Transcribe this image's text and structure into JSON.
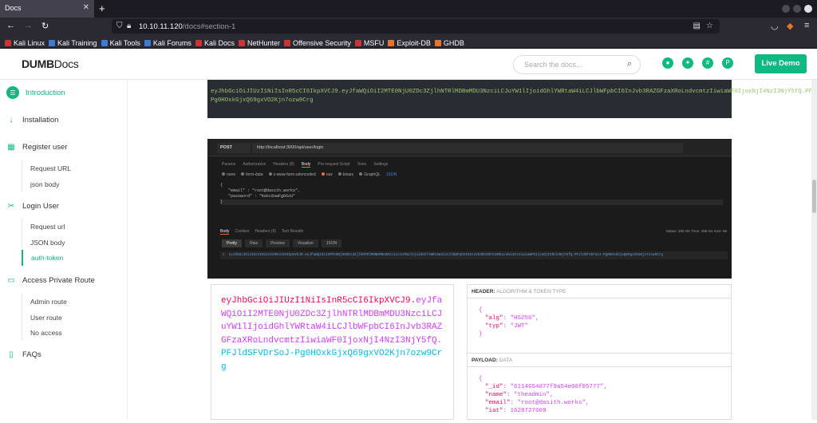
{
  "browser": {
    "tab_title": "Docs",
    "url_host": "10.10.11.120",
    "url_path": "/docs#section-1"
  },
  "bookmarks": [
    "Kali Linux",
    "Kali Training",
    "Kali Tools",
    "Kali Forums",
    "Kali Docs",
    "NetHunter",
    "Offensive Security",
    "MSFU",
    "Exploit-DB",
    "GHDB"
  ],
  "header": {
    "logo_bold": "DUMB",
    "logo_rest": "Docs",
    "search_placeholder": "Search the docs...",
    "live_demo": "Live Demo"
  },
  "sidebar": {
    "sections": [
      {
        "label": "Introduction",
        "icon": "map-signs-icon"
      },
      {
        "label": "Installation",
        "icon": "arrow-down-icon"
      },
      {
        "label": "Register user",
        "icon": "box-icon"
      },
      {
        "label": "Login User",
        "icon": "tools-icon"
      },
      {
        "label": "Access Private Route",
        "icon": "laptop-icon"
      },
      {
        "label": "FAQs",
        "icon": "tablet-icon"
      }
    ],
    "register_sub": [
      "Request URL",
      "json body"
    ],
    "login_sub": [
      "Request url",
      "JSON body",
      "auth-token"
    ],
    "private_sub": [
      "Admin route",
      "User route",
      "No access"
    ]
  },
  "token_code": "eyJhbGciOiJIUzI1NiIsInR5cCI6IkpXVCJ9.eyJfaWQiOiI2MTE0NjU0ZDc3ZjlhNTRlMDBmMDU3NzciLCJuYW1lIjoidGhlYWRtaW4iLCJlbWFpbCI6InJvb3RAZGFzaXRoLndvcmtzIiwiaWF0IjoxNjI4NzI3NjY5fQ.PFJldSFVDrSoJ-Pg0HOxkGjxQ69gxVO2Kjn7ozw9Crg",
  "postman": {
    "method": "POST",
    "url": "http://localhost:3000/api/user/login",
    "tabs": [
      "Params",
      "Authorization",
      "Headers (8)",
      "Body",
      "Pre-request Script",
      "Tests",
      "Settings"
    ],
    "body_types": [
      "none",
      "form-data",
      "x-www-form-urlencoded",
      "raw",
      "binary",
      "GraphQL",
      "JSON"
    ],
    "code_lines": [
      "{",
      "\"email\" : \"root@dasith.works\",",
      "\"password\" : \"Kekc8swFgD6zU\"",
      "}"
    ],
    "response_tabs": [
      "Body",
      "Cookies",
      "Headers (9)",
      "Test Results"
    ],
    "status": "Status: 200 OK   Time: 458 ms   Size: 66",
    "format_tabs": [
      "Pretty",
      "Raw",
      "Preview",
      "Visualize",
      "JSON"
    ],
    "response": "eyJhbGciOiJIUzI1NiIsInR5cCI6IkpXVCJ9.eyJfaWQiOiI2MTE0NjU0ZDc3ZjlhNTRlMDBmMDU3NzciLCJuYW1lIjoidGhlYWRtaW4iLCJlbWFpbCI6InJvb3RAZGFzaXRoLndvcmtzIiwiaWF0IjoxNjI4NzI3NjY5fQ.PFJldSFVDrSoJ-Pg0HOxkGjxQ69gxVO2Kjn7ozw9Crg"
  },
  "jwt": {
    "header_part": "eyJhbGciOiJIUzI1NiIsInR5cCI6IkpXVCJ9.",
    "payload_part": "eyJfaWQiOiI2MTE0NjU0ZDc3ZjlhNTRlMDBmMDU3NzciLCJuYW1lIjoidGhlYWRtaW4iLCJlbWFpbCI6InJvb3RAZGFzaXRoLndvcmtzIiwiaWF0IjoxNjI4NzI3NjY5fQ.",
    "sig_part": "PFJldSFVDrSoJ-Pg0HOxkGjxQ69gxVO2Kjn7ozw9Crg",
    "header_title": "HEADER:",
    "header_sub": "ALGORITHM & TOKEN TYPE",
    "payload_title": "PAYLOAD:",
    "payload_sub": "DATA",
    "alg_key": "\"alg\"",
    "alg_val": "\"HS256\"",
    "typ_key": "\"typ\"",
    "typ_val": "\"JWT\"",
    "id_key": "\"_id\"",
    "id_val": "\"6114654d77f9a54e00f05777\"",
    "name_key": "\"name\"",
    "name_val": "\"theadmin\"",
    "email_key": "\"email\"",
    "email_val": "\"root@dasith.works\"",
    "iat_key": "\"iat\"",
    "iat_val": "1628727669"
  }
}
